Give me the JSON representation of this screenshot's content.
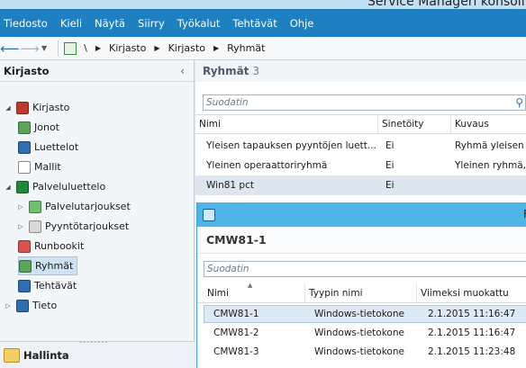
{
  "window": {
    "title": "Service Manageri konsoli"
  },
  "menu": [
    "Tiedosto",
    "Kieli",
    "Näytä",
    "Siirry",
    "Työkalut",
    "Tehtävät",
    "Ohje"
  ],
  "breadcrumb": {
    "root": "\\",
    "items": [
      "Kirjasto",
      "Kirjasto",
      "Ryhmät"
    ]
  },
  "leftpane": {
    "title": "Kirjasto",
    "collapse": "‹",
    "tree": [
      {
        "label": "Kirjasto",
        "icon": "library-icon",
        "color": "#c0392b",
        "expander": "◢"
      },
      {
        "label": "Jonot",
        "icon": "queue-icon",
        "color": "#5aa55a"
      },
      {
        "label": "Luettelot",
        "icon": "list-icon",
        "color": "#2f6fb1"
      },
      {
        "label": "Mallit",
        "icon": "template-icon",
        "color": "#ffffff"
      },
      {
        "label": "Palveluluettelo",
        "icon": "service-catalog-icon",
        "color": "#1e8a3a",
        "expander": "◢"
      },
      {
        "label": "Palvelutarjoukset",
        "icon": "service-offering-icon",
        "color": "#6fbf6f",
        "expander": "▷"
      },
      {
        "label": "Pyyntötarjoukset",
        "icon": "request-offering-icon",
        "color": "#d8d8d8",
        "expander": "▷"
      },
      {
        "label": "Runbookit",
        "icon": "runbook-icon",
        "color": "#d9534f"
      },
      {
        "label": "Ryhmät",
        "icon": "groups-icon",
        "color": "#5aa55a",
        "selected": true
      },
      {
        "label": "Tehtävät",
        "icon": "tasks-icon",
        "color": "#2f6fb1"
      },
      {
        "label": "Tieto",
        "icon": "knowledge-icon",
        "color": "#2f6fb1",
        "expander": "▷"
      }
    ],
    "bottom": "Hallinta"
  },
  "main": {
    "title": "Ryhmät",
    "count": "3",
    "filter_placeholder": "Suodatin",
    "columns": [
      "Nimi",
      "Sinetöity",
      "Kuvaus"
    ],
    "rows": [
      [
        "Yleisen tapauksen pyyntöjen luett...",
        "Ei",
        "Ryhmä yleisen t"
      ],
      [
        "Yleinen operaattoriryhmä",
        "Ei",
        "Yleinen ryhmä,"
      ],
      [
        "Win81 pct",
        "Ei",
        ""
      ]
    ]
  },
  "dialog": {
    "title": "F",
    "name": "CMW81-1",
    "filter_placeholder": "Suodatin",
    "columns": [
      "Nimi",
      "Tyypin nimi",
      "Viimeksi muokattu"
    ],
    "rows": [
      [
        "CMW81-1",
        "Windows-tietokone",
        "2.1.2015 11:16:47"
      ],
      [
        "CMW81-2",
        "Windows-tietokone",
        "2.1.2015 11:16:47"
      ],
      [
        "CMW81-3",
        "Windows-tietokone",
        "2.1.2015 11:23:48"
      ]
    ]
  }
}
